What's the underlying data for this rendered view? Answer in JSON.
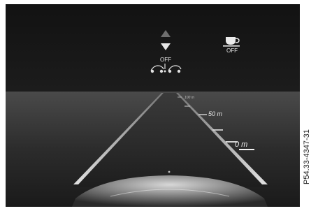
{
  "status_icons": {
    "distance_assist_state": "OFF",
    "attention_assist_state": "OFF",
    "distance_assist_icon": "vehicle-distance-icon",
    "attention_assist_icon": "coffee-cup-icon",
    "adjust_icon": "up-down-arrows-icon"
  },
  "distance_scale": {
    "far_label": "100 m",
    "mid_label": "50 m",
    "near_label": "0 m"
  },
  "reference_code": "P54.33-4347-31",
  "colors": {
    "panel_bg": "#151515",
    "text": "#e8e8e8",
    "lane_line": "#d0d0d0",
    "road_dark": "#262626"
  }
}
